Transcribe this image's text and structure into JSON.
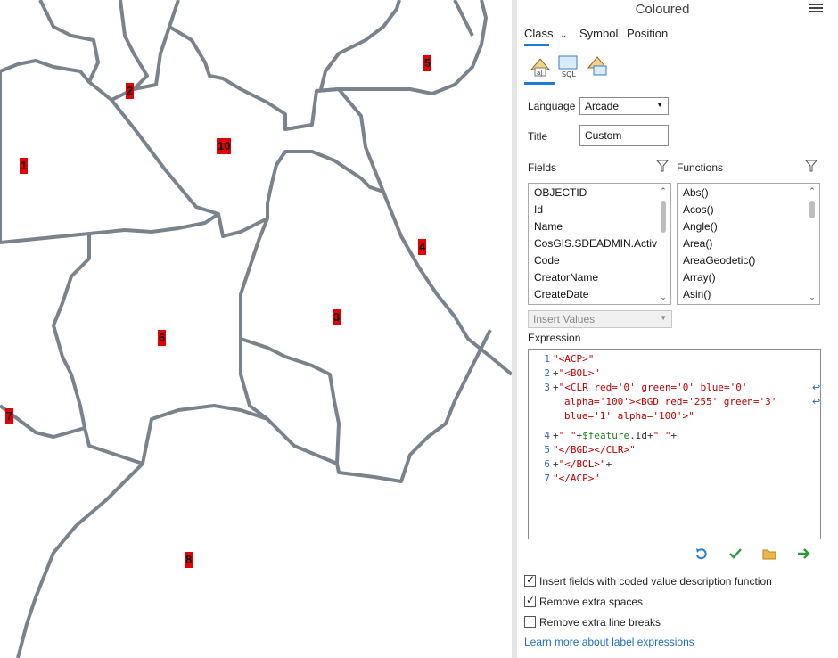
{
  "map": {
    "labels": [
      {
        "id": "1",
        "text": "1"
      },
      {
        "id": "2",
        "text": "2"
      },
      {
        "id": "3",
        "text": "3"
      },
      {
        "id": "4",
        "text": "4"
      },
      {
        "id": "5",
        "text": "5"
      },
      {
        "id": "6",
        "text": "6"
      },
      {
        "id": "7",
        "text": "7"
      },
      {
        "id": "8",
        "text": "8"
      },
      {
        "id": "10",
        "text": "10"
      }
    ],
    "label_color": "#e60000",
    "boundary_color": "#7a838c"
  },
  "panel": {
    "title": "Coloured",
    "tabs": {
      "class": "Class",
      "symbol": "Symbol",
      "position": "Position"
    },
    "icons": [
      "label-class-icon",
      "sql-icon",
      "label-filter-icon"
    ],
    "language": {
      "label": "Language",
      "value": "Arcade"
    },
    "title_field": {
      "label": "Title",
      "value": "Custom"
    },
    "fields": {
      "label": "Fields",
      "items": [
        "OBJECTID",
        "Id",
        "Name",
        "CosGIS.SDEADMIN.Activit",
        "Code",
        "CreatorName",
        "CreateDate"
      ]
    },
    "functions": {
      "label": "Functions",
      "items": [
        "Abs()",
        "Acos()",
        "Angle()",
        "Area()",
        "AreaGeodetic()",
        "Array()",
        "Asin()"
      ]
    },
    "insert_values": "Insert Values",
    "expression": {
      "label": "Expression",
      "line_numbers": [
        "1",
        "2",
        "3",
        "4",
        "5",
        "6",
        "7"
      ],
      "lines": {
        "l1": "\"<ACP>\"",
        "l2_op": "+",
        "l2": "\"<BOL>\"",
        "l3_op": "+",
        "l3a": "\"<CLR red='0' green='0' blue='0'",
        "l3b": "alpha='100'><BGD red='255' green='3'",
        "l3c": "blue='1' alpha='100'>\"",
        "l4_op1": "+",
        "l4_s1": "\" \"",
        "l4_op2": "+",
        "l4_fld": "$feature",
        "l4_prop": ".Id",
        "l4_op3": "+",
        "l4_s2": "\" \"",
        "l4_op4": "+",
        "l5": "\"</BGD></CLR>\"",
        "l6_op": "+",
        "l6": "\"</BOL>\"",
        "l6_op2": "+",
        "l7": "\"</ACP>\""
      }
    },
    "toolbar_icons": [
      "undo-icon",
      "verify-icon",
      "open-folder-icon",
      "apply-arrow-icon"
    ],
    "options": [
      {
        "label": "Insert fields with coded value description function",
        "checked": true
      },
      {
        "label": "Remove extra spaces",
        "checked": true
      },
      {
        "label": "Remove extra line breaks",
        "checked": false
      }
    ],
    "learn_more": "Learn more about label expressions"
  }
}
